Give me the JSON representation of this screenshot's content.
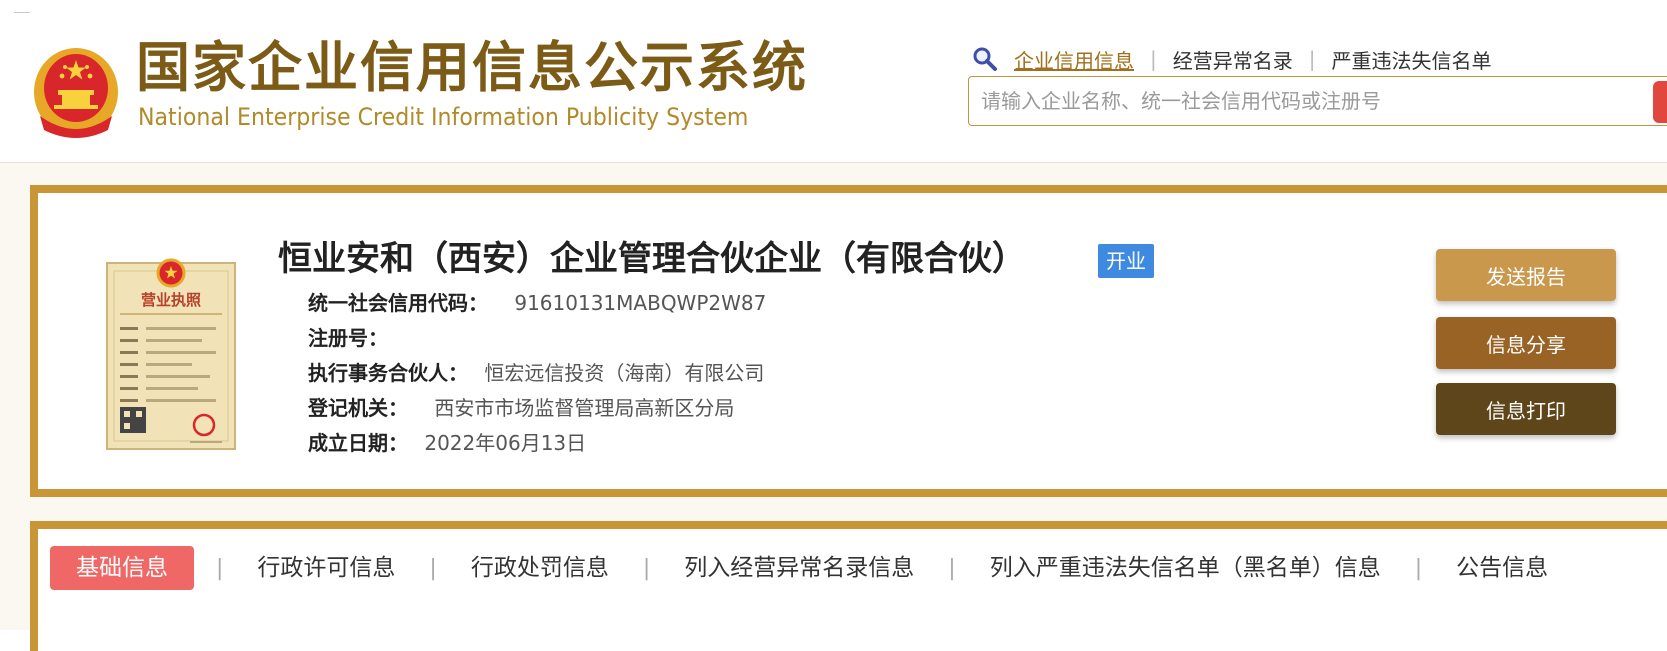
{
  "header": {
    "title_cn": "国家企业信用信息公示系统",
    "title_en": "National Enterprise Credit Information Publicity System",
    "nav": [
      {
        "label": "企业信用信息",
        "active": true
      },
      {
        "label": "经营异常名录",
        "active": false
      },
      {
        "label": "严重违法失信名单",
        "active": false
      }
    ],
    "search_placeholder": "请输入企业名称、统一社会信用代码或注册号"
  },
  "company": {
    "name": "恒业安和（西安）企业管理合伙企业（有限合伙）",
    "status": "开业",
    "fields": [
      {
        "label": "统一社会信用代码：",
        "value": "91610131MABQWP2W87"
      },
      {
        "label": "注册号：",
        "value": ""
      },
      {
        "label": "执行事务合伙人：",
        "value": "恒宏远信投资（海南）有限公司"
      },
      {
        "label": "登记机关：",
        "value": "西安市市场监督管理局高新区分局"
      },
      {
        "label": "成立日期：",
        "value": "2022年06月13日"
      }
    ],
    "license_title": "营业执照"
  },
  "actions": {
    "send_report": "发送报告",
    "share": "信息分享",
    "print": "信息打印"
  },
  "tabs": [
    {
      "label": "基础信息",
      "active": true
    },
    {
      "label": "行政许可信息",
      "active": false
    },
    {
      "label": "行政处罚信息",
      "active": false
    },
    {
      "label": "列入经营异常名录信息",
      "active": false
    },
    {
      "label": "列入严重违法失信名单（黑名单）信息",
      "active": false
    },
    {
      "label": "公告信息",
      "active": false
    }
  ],
  "colors": {
    "brand_gold": "#c99637",
    "title_brown": "#7c5b16",
    "status_blue": "#3f8ae1",
    "active_tab": "#f06866",
    "search_red": "#e2473d"
  },
  "icons": [
    "national-emblem-icon",
    "search-magnifier-icon",
    "business-license-icon"
  ]
}
